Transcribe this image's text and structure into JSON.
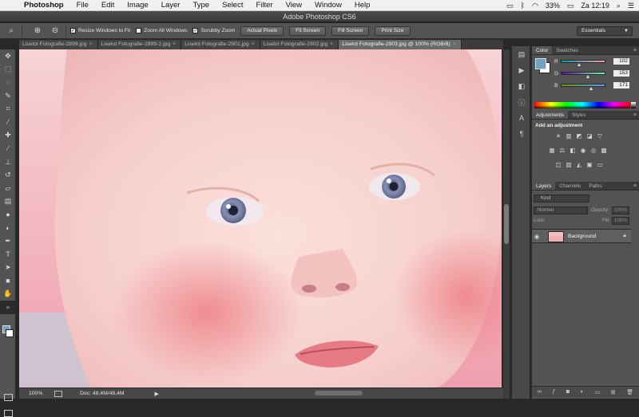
{
  "menubar": {
    "app_name": "Photoshop",
    "items": [
      "File",
      "Edit",
      "Image",
      "Layer",
      "Type",
      "Select",
      "Filter",
      "View",
      "Window",
      "Help"
    ],
    "battery": "33%",
    "clock": "Za 12:19"
  },
  "window": {
    "title": "Adobe Photoshop CS6"
  },
  "options": {
    "resize_windows": "Resize Windows to Fit",
    "zoom_all": "Zoom All Windows",
    "scrubby_zoom": "Scrubby Zoom",
    "actual_pixels": "Actual Pixels",
    "fit_screen": "Fit Screen",
    "fill_screen": "Fill Screen",
    "print_size": "Print Size",
    "workspace": "Essentials"
  },
  "tabs": [
    {
      "label": "Liselot Fotografie-2899.jpg"
    },
    {
      "label": "Liselot Fotografie-2899-2.jpg"
    },
    {
      "label": "Liselot Fotografie-2901.jpg"
    },
    {
      "label": "Liselot Fotografie-2902.jpg"
    },
    {
      "label": "Liselot Fotografie-2903.jpg @ 100% (RGB/8)"
    }
  ],
  "status": {
    "zoom": "100%",
    "doc": "Doc: 48,4M/48,4M"
  },
  "color_panel": {
    "tabs": [
      "Color",
      "Swatches"
    ],
    "foreground": "#6fa4be",
    "r": {
      "label": "R",
      "value": "102"
    },
    "g": {
      "label": "G",
      "value": "153"
    },
    "b": {
      "label": "B",
      "value": "171"
    }
  },
  "adjustments_panel": {
    "tabs": [
      "Adjustments",
      "Styles"
    ],
    "title": "Add an adjustment"
  },
  "layers_panel": {
    "tabs": [
      "Layers",
      "Channels",
      "Paths"
    ],
    "kind": "Kind",
    "blend_mode": "Normal",
    "opacity_label": "Opacity:",
    "opacity_value": "100%",
    "lock_label": "Lock:",
    "fill_label": "Fill:",
    "fill_value": "100%",
    "layer_name": "Background"
  }
}
